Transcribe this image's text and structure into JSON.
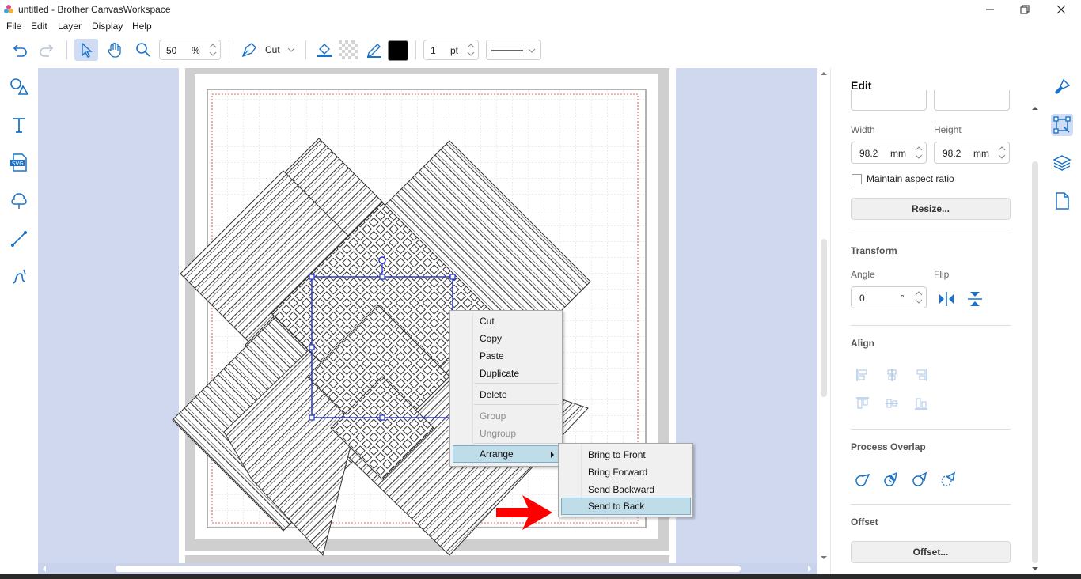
{
  "window": {
    "title": "untitled - Brother CanvasWorkspace"
  },
  "menu": {
    "file": "File",
    "edit": "Edit",
    "layer": "Layer",
    "display": "Display",
    "help": "Help"
  },
  "toolbar": {
    "zoom_value": "50",
    "zoom_unit": "%",
    "cut_mode": "Cut",
    "line_width_value": "1",
    "line_width_unit": "pt",
    "line_color": "#000000",
    "accent": "#1a73c8"
  },
  "context_menu": {
    "items": [
      "Cut",
      "Copy",
      "Paste",
      "Duplicate",
      "Delete",
      "Group",
      "Ungroup",
      "Arrange"
    ],
    "disabled": [
      "Group",
      "Ungroup"
    ]
  },
  "arrange_menu": {
    "items": [
      "Bring to Front",
      "Bring Forward",
      "Send Backward",
      "Send to Back"
    ],
    "highlighted": "Send to Back",
    "highlight_color": "#bfdde9"
  },
  "annotation": {
    "arrow_color": "#ff0000"
  },
  "edit_panel": {
    "title": "Edit",
    "width_label": "Width",
    "height_label": "Height",
    "width_value": "98.2",
    "height_value": "98.2",
    "unit": "mm",
    "maintain_aspect": "Maintain aspect ratio",
    "resize_button": "Resize...",
    "transform_title": "Transform",
    "angle_label": "Angle",
    "flip_label": "Flip",
    "angle_value": "0",
    "angle_unit": "°",
    "align_title": "Align",
    "process_overlap_title": "Process Overlap",
    "offset_title": "Offset",
    "offset_button": "Offset..."
  },
  "icons": {
    "undo": "undo-icon",
    "redo": "redo-icon",
    "select": "pointer-icon",
    "hand": "hand-icon",
    "zoom": "magnifier-icon",
    "pen": "pen-icon",
    "fill": "fill-bucket-icon",
    "pattern": "transparent-pattern-icon",
    "line_color": "pencil-icon"
  }
}
